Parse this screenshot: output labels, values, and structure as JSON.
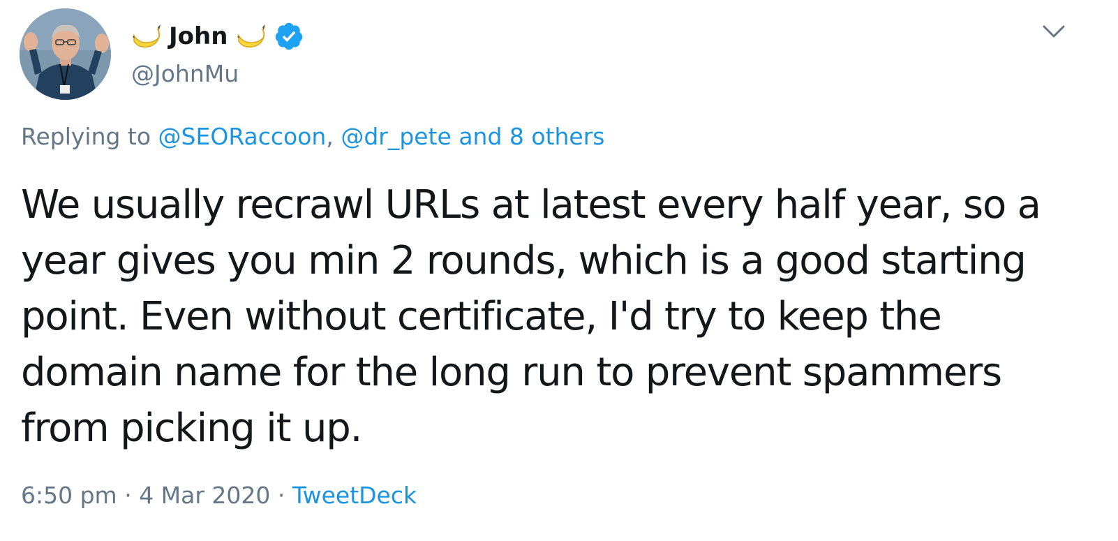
{
  "author": {
    "display_name": "John",
    "handle": "@JohnMu",
    "name_emoji": "banana",
    "verified": true
  },
  "replying": {
    "prefix": "Replying to ",
    "mention_1": "@SEORaccoon",
    "separator": ", ",
    "mention_2": "@dr_pete",
    "others": "and 8 others"
  },
  "tweet": {
    "text": "We usually recrawl URLs at latest every half year, so a year gives you min 2 rounds, which is a good starting point. Even without certificate, I'd try to keep the domain name for the long run to prevent spammers from picking it up."
  },
  "meta": {
    "time": "6:50 pm",
    "dot": " · ",
    "date": "4 Mar 2020",
    "source": "TweetDeck"
  },
  "colors": {
    "link": "#1b95e0",
    "secondary": "#657786",
    "text": "#14171a",
    "verified": "#1da1f2"
  },
  "icons": {
    "menu": "chevron-down-icon",
    "verified": "verified-badge-icon",
    "emoji": "banana-icon"
  }
}
